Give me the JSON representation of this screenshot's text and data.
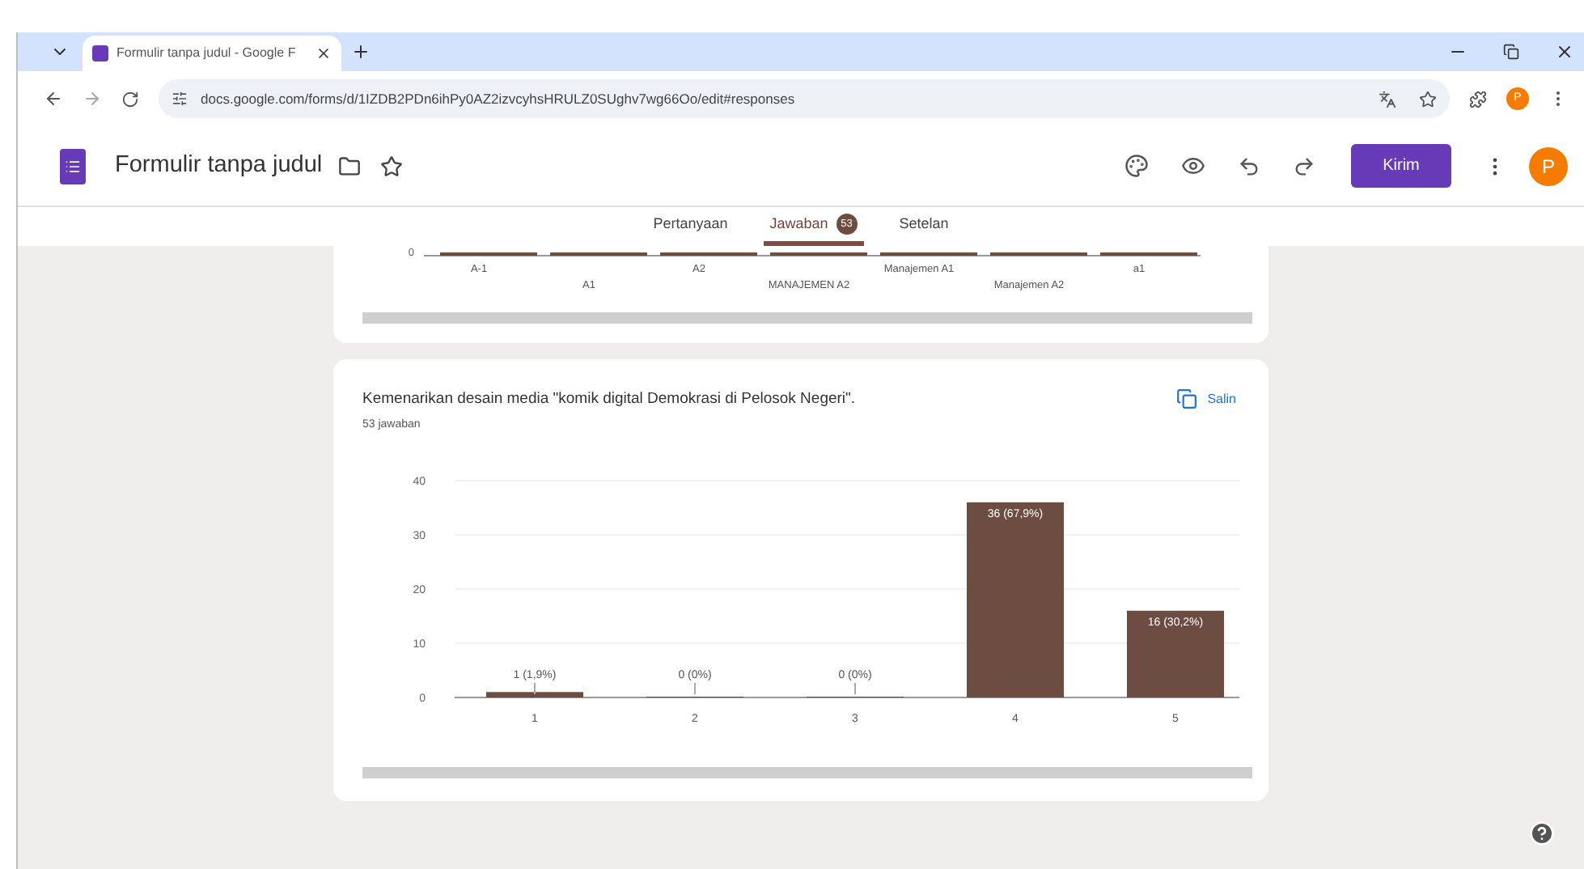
{
  "browser": {
    "tab_title": "Formulir tanpa judul - Google F",
    "url": "docs.google.com/forms/d/1IZDB2PDn6ihPy0AZ2izvcyhsHRULZ0SUghv7wg66Oo/edit#responses",
    "profile_initial": "P"
  },
  "header": {
    "title": "Formulir tanpa judul",
    "send_button": "Kirim",
    "avatar_initial": "P"
  },
  "tabs": [
    {
      "label": "Pertanyaan",
      "selected": false
    },
    {
      "label": "Jawaban",
      "selected": true,
      "badge": "53"
    },
    {
      "label": "Setelan",
      "selected": false
    }
  ],
  "previous_chart": {
    "y_tick": "0",
    "categories": [
      "A-1",
      "A1",
      "A2",
      "MANAJEMEN A2",
      "Manajemen A1",
      "Manajemen A2",
      "a1"
    ]
  },
  "question_card": {
    "title": "Kemenarikan desain media \"komik digital Demokrasi di Pelosok Negeri\".",
    "copy_button": "Salin",
    "response_count": "53 jawaban",
    "chart_data": {
      "type": "bar",
      "categories": [
        "1",
        "2",
        "3",
        "4",
        "5"
      ],
      "series": [
        {
          "color": "#6d4c41",
          "values": [
            1,
            0,
            0,
            36,
            16
          ]
        }
      ],
      "grid": true,
      "ylim": [
        0,
        40
      ],
      "yticks": [
        0,
        10,
        20,
        30,
        40
      ],
      "value_labels": [
        "1 (1,9%)",
        "0 (0%)",
        "0 (0%)",
        "36 (67,9%)",
        "16 (30,2%)"
      ]
    }
  }
}
